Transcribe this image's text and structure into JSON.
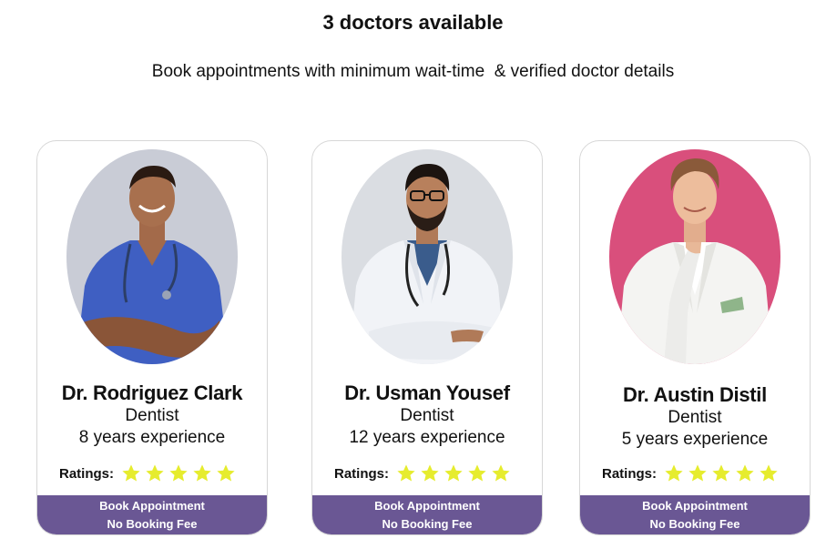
{
  "header": {
    "title": "3 doctors available",
    "subtitle": "Book appointments with minimum wait-time  & verified doctor details"
  },
  "doctors": [
    {
      "name": "Dr. Rodriguez Clark",
      "specialty": "Dentist",
      "experience": "8 years experience",
      "ratings_label": "Ratings:",
      "rating": 5,
      "photo_background": "#c9ccd6",
      "button_line1": "Book Appointment",
      "button_line2": "No Booking Fee"
    },
    {
      "name": "Dr. Usman Yousef",
      "specialty": "Dentist",
      "experience": "12 years experience",
      "ratings_label": "Ratings:",
      "rating": 5,
      "photo_background": "#dadde2",
      "button_line1": "Book Appointment",
      "button_line2": "No Booking Fee"
    },
    {
      "name": "Dr. Austin Distil",
      "specialty": "Dentist",
      "experience": "5 years experience",
      "ratings_label": "Ratings:",
      "rating": 5,
      "photo_background": "#d94f7c",
      "button_line1": "Book Appointment",
      "button_line2": "No Booking Fee"
    }
  ],
  "colors": {
    "button": "#6a5794",
    "star": "#e6ec2e",
    "card_border": "#d7d7d7"
  },
  "icons": {
    "rating_star": "star-icon",
    "doctor_photo": "doctor-portrait"
  }
}
